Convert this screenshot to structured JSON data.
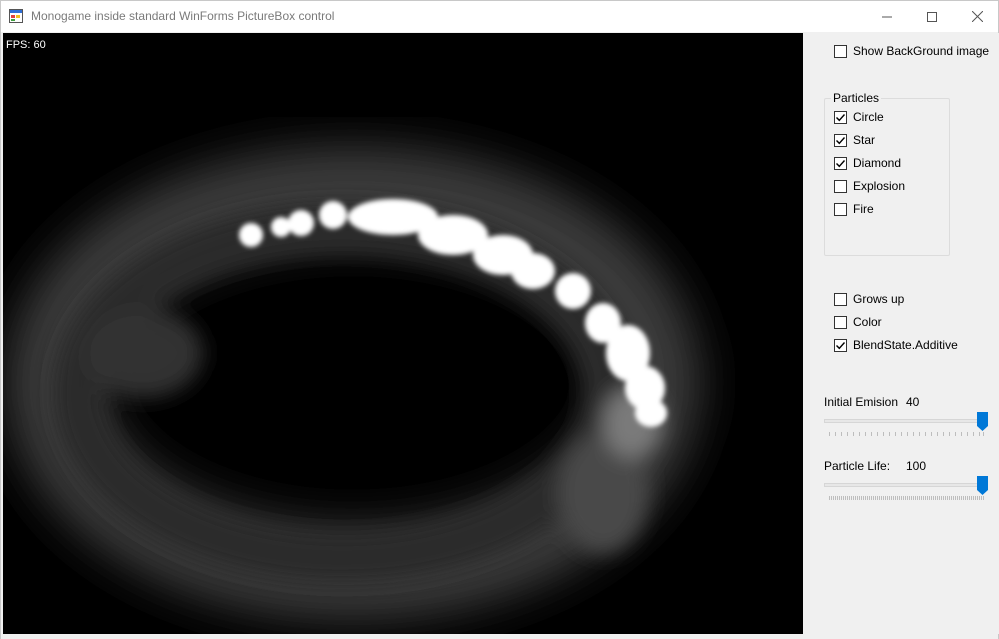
{
  "window": {
    "title": "Monogame inside standard WinForms PictureBox control",
    "icon": "app-window-icon",
    "controls": {
      "minimize": "minimize-icon",
      "maximize": "maximize-icon",
      "close": "close-icon"
    }
  },
  "viewport": {
    "fps_label": "FPS: 60",
    "background": "#000000"
  },
  "panel": {
    "show_background": {
      "label": "Show BackGround image",
      "checked": false
    },
    "particles_group": {
      "legend": "Particles",
      "items": [
        {
          "label": "Circle",
          "checked": true
        },
        {
          "label": "Star",
          "checked": true
        },
        {
          "label": "Diamond",
          "checked": true
        },
        {
          "label": "Explosion",
          "checked": false
        },
        {
          "label": "Fire",
          "checked": false
        }
      ]
    },
    "options": [
      {
        "label": "Grows up",
        "checked": false
      },
      {
        "label": "Color",
        "checked": false
      },
      {
        "label": "BlendState.Additive",
        "checked": true
      }
    ],
    "initial_emission": {
      "label": "Initial Emision",
      "value": "40",
      "level": 1.0
    },
    "particle_life": {
      "label": "Particle Life:",
      "value": "100",
      "level": 1.0
    }
  },
  "colors": {
    "accent": "#0078d7",
    "panel_bg": "#f0f0f0"
  }
}
